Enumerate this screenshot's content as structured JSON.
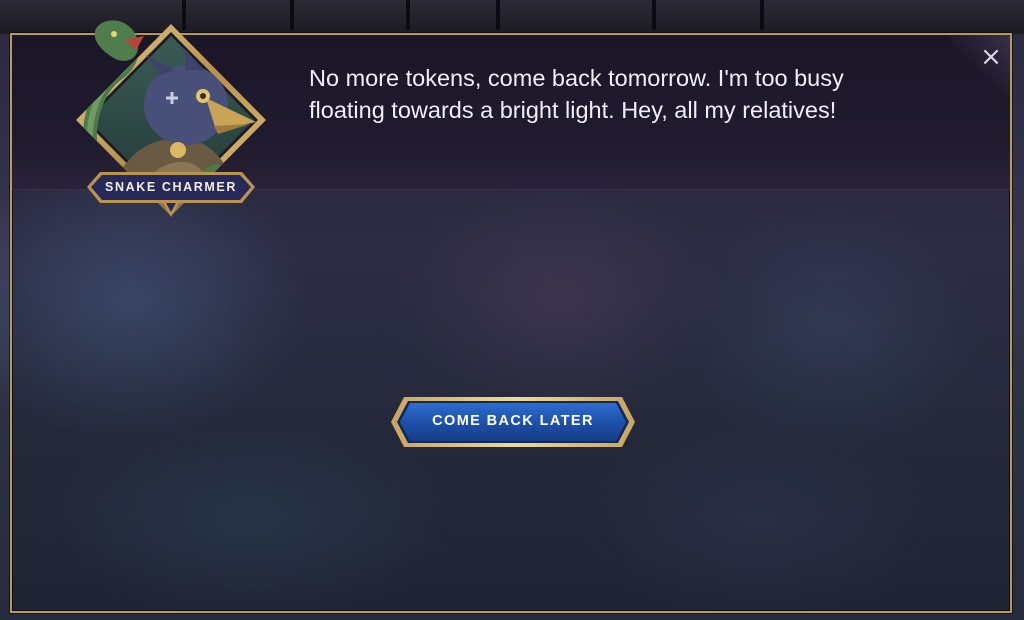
{
  "npc": {
    "name": "SNAKE CHARMER",
    "portrait_icon": "raven-with-snake-portrait"
  },
  "dialogue": {
    "text": "No more tokens, come back tomorrow. I'm too busy floating towards a bright light. Hey, all my relatives!"
  },
  "actions": {
    "primary_label": "COME BACK LATER",
    "close_icon": "×"
  },
  "colors": {
    "frame_gold": "#b89a58",
    "button_blue": "#1d4fa6",
    "banner_navy": "#27295a",
    "panel_dark": "#1a1627"
  }
}
